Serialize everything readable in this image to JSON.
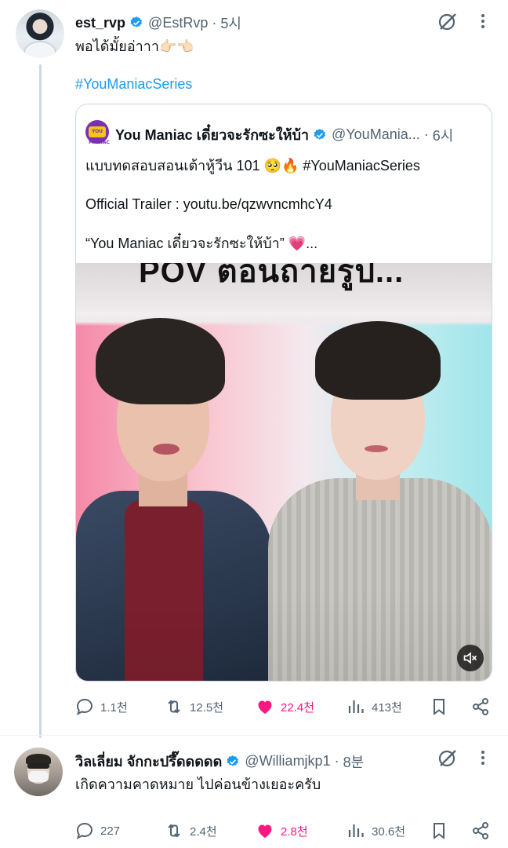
{
  "tweet": {
    "author_name": "est_rvp",
    "author_handle": "@EstRvp",
    "separator": "·",
    "time": "5시",
    "text": "พอได้มั้ยอ่าาา👉🏻👈🏻",
    "hashtag": "#YouManiacSeries",
    "quote": {
      "author_name": "You Maniac เดี๋ยวจะรักซะให้บ้า",
      "author_handle": "@YouMania...",
      "separator": "·",
      "time": "6시",
      "avatar_text": "YOU MANIAC",
      "line1": "แบบทดสอบสอนเต้าหู้วีน 101 🥺🔥 #YouManiacSeries",
      "line2": "Official Trailer : youtu.be/qzwvncmhcY4",
      "line3": "“You Maniac เดี๋ยวจะรักซะให้บ้า” 💗...",
      "video_caption_partial": "POV ตอนถ่ายรูป..."
    },
    "actions": {
      "replies": "1.1천",
      "retweets": "12.5천",
      "likes": "22.4천",
      "views": "413천"
    }
  },
  "reply": {
    "author_name": "วิลเลี่ยม จักกะปรึ๊ดดดดด",
    "author_handle": "@Williamjkp1",
    "separator": "·",
    "time": "8분",
    "text": "เกิดความคาดหมาย ไปค่อนข้างเยอะครับ",
    "actions": {
      "replies": "227",
      "retweets": "2.4천",
      "likes": "2.8천",
      "views": "30.6천"
    }
  },
  "colors": {
    "accent": "#1d9bf0",
    "like": "#f91880",
    "muted": "#536471",
    "verified": "#1d9bf0"
  },
  "icons": [
    "grok-icon",
    "more-icon",
    "verified-icon",
    "reply-icon",
    "retweet-icon",
    "like-icon",
    "views-icon",
    "bookmark-icon",
    "share-icon",
    "mute-icon"
  ]
}
